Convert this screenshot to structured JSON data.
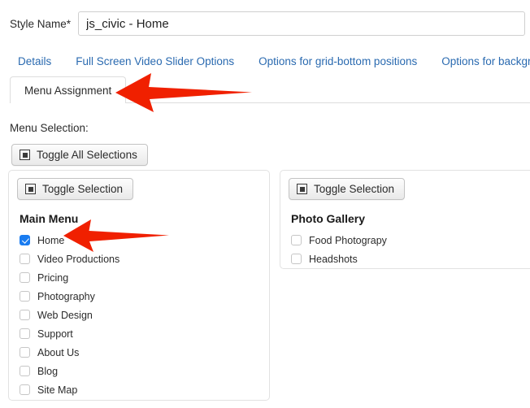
{
  "form": {
    "style_name_label": "Style Name",
    "required_marker": "*",
    "style_name_value": "js_civic - Home",
    "style_name_placeholder": ""
  },
  "tabs": {
    "links": [
      {
        "label": "Details"
      },
      {
        "label": "Full Screen Video Slider Options"
      },
      {
        "label": "Options for grid-bottom positions"
      },
      {
        "label": "Options for backgrou"
      }
    ],
    "active_tab": "Menu Assignment"
  },
  "menu_selection": {
    "heading": "Menu Selection:",
    "toggle_all_label": "Toggle All Selections",
    "toggle_icon": "square-in-square-icon"
  },
  "panels": [
    {
      "toggle_label": "Toggle Selection",
      "title": "Main Menu",
      "items": [
        {
          "label": "Home",
          "checked": true
        },
        {
          "label": "Video Productions",
          "checked": false
        },
        {
          "label": "Pricing",
          "checked": false
        },
        {
          "label": "Photography",
          "checked": false
        },
        {
          "label": "Web Design",
          "checked": false
        },
        {
          "label": "Support",
          "checked": false
        },
        {
          "label": "About Us",
          "checked": false
        },
        {
          "label": "Blog",
          "checked": false
        },
        {
          "label": "Site Map",
          "checked": false
        }
      ]
    },
    {
      "toggle_label": "Toggle Selection",
      "title": "Photo Gallery",
      "items": [
        {
          "label": "Food Photograpy",
          "checked": false
        },
        {
          "label": "Headshots",
          "checked": false
        }
      ]
    }
  ],
  "annotations": {
    "arrow_color": "#f02000",
    "arrows": [
      {
        "name": "arrow-pointing-menu-assignment-tab"
      },
      {
        "name": "arrow-pointing-home-checkbox"
      }
    ]
  },
  "colors": {
    "tab_link": "#2a6ab0",
    "checkbox_checked": "#1a7cf0",
    "panel_border": "#e2e2e2",
    "arrow_red": "#f02000"
  }
}
